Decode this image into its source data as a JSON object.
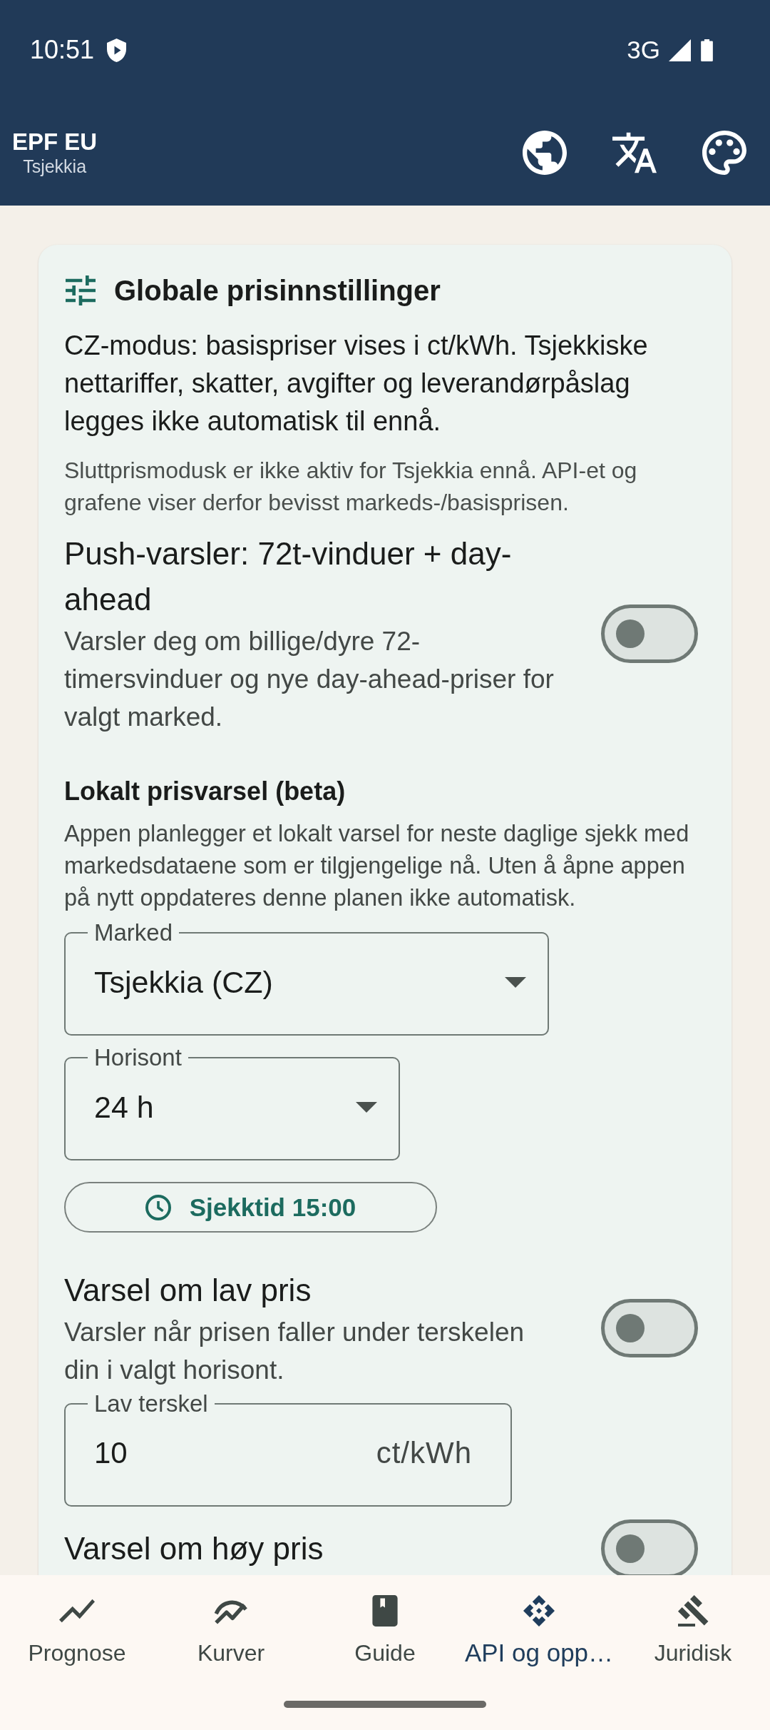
{
  "status_bar": {
    "time": "10:51",
    "network": "3G"
  },
  "app_bar": {
    "title": "EPF EU",
    "subtitle": "Tsjekkia"
  },
  "card": {
    "title": "Globale prisinnstillinger",
    "intro": "CZ-modus: basispriser vises i ct/kWh. Tsjekkiske nettariffer, skatter, avgifter og leverandørpåslag legges ikke automatisk til ennå.",
    "note": "Sluttprismodusk er ikke aktiv for Tsjekkia ennå. API-et og grafene viser derfor bevisst markeds-/basisprisen.",
    "items": [
      {
        "kind": "toggle",
        "title": "Push-varsler: 72t-vinduer + day-ahead",
        "description": "Varsler deg om billige/dyre 72-timersvinduer og nye day-ahead-priser for valgt marked.",
        "on": false
      },
      {
        "kind": "heading",
        "title": "Lokalt prisvarsel (beta)",
        "description": "Appen planlegger et lokalt varsel for neste daglige sjekk med markedsdataene som er tilgjengelige nå. Uten å åpne appen på nytt oppdateres denne planen ikke automatisk."
      },
      {
        "kind": "dropdown",
        "label": "Marked",
        "value": "Tsjekkia (CZ)"
      },
      {
        "kind": "dropdown",
        "label": "Horisont",
        "value": "24 h"
      },
      {
        "kind": "time_button",
        "label": "Sjekktid 15:00"
      },
      {
        "kind": "toggle",
        "title": "Varsel om lav pris",
        "description": "Varsler når prisen faller under terskelen din i valgt horisont.",
        "on": false
      },
      {
        "kind": "number_field",
        "label": "Lav terskel",
        "value": "10",
        "unit": "ct/kWh"
      },
      {
        "kind": "toggle",
        "title": "Varsel om høy pris",
        "on": false
      }
    ]
  },
  "bottom_nav": [
    {
      "label": "Prognose",
      "selected": false
    },
    {
      "label": "Kurver",
      "selected": false
    },
    {
      "label": "Guide",
      "selected": false
    },
    {
      "label": "API og opp…",
      "selected": true
    },
    {
      "label": "Juridisk",
      "selected": false
    }
  ]
}
